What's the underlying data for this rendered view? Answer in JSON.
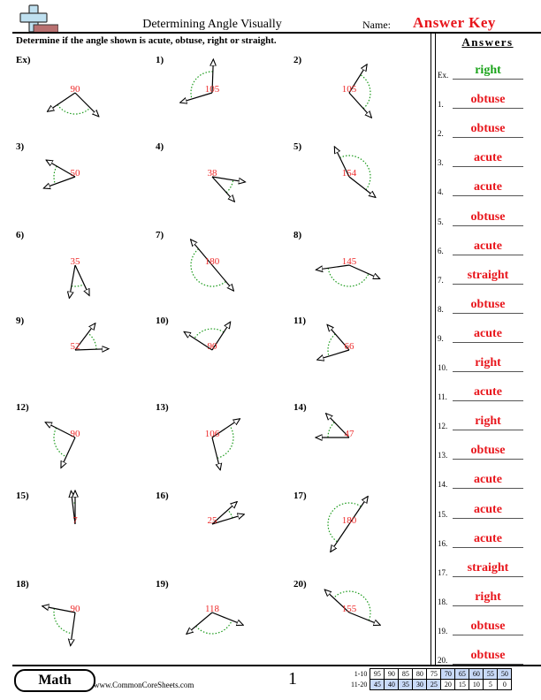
{
  "header": {
    "title": "Determining Angle Visually",
    "name_label": "Name:",
    "name_value": "Answer Key",
    "logo_icon": "plus-minus-logo-icon"
  },
  "instructions": "Determine if the angle shown is acute, obtuse, right or straight.",
  "problems": [
    {
      "label": "Ex)",
      "measure": "90",
      "rays": [
        214,
        315
      ]
    },
    {
      "label": "1)",
      "measure": "105",
      "rays": [
        88,
        197
      ]
    },
    {
      "label": "2)",
      "measure": "105",
      "rays": [
        58,
        312
      ]
    },
    {
      "label": "3)",
      "measure": "50",
      "rays": [
        150,
        200
      ]
    },
    {
      "label": "4)",
      "measure": "38",
      "rays": [
        351,
        312
      ]
    },
    {
      "label": "5)",
      "measure": "154",
      "rays": [
        116,
        322
      ]
    },
    {
      "label": "6)",
      "measure": "35",
      "rays": [
        260,
        295
      ]
    },
    {
      "label": "7)",
      "measure": "180",
      "rays": [
        130,
        310
      ]
    },
    {
      "label": "8)",
      "measure": "145",
      "rays": [
        188,
        336
      ]
    },
    {
      "label": "9)",
      "measure": "52",
      "rays": [
        53,
        2
      ]
    },
    {
      "label": "10)",
      "measure": "90",
      "rays": [
        147,
        57
      ]
    },
    {
      "label": "11)",
      "measure": "66",
      "rays": [
        131,
        197
      ]
    },
    {
      "label": "12)",
      "measure": "90",
      "rays": [
        153,
        245
      ]
    },
    {
      "label": "13)",
      "measure": "106",
      "rays": [
        34,
        284
      ]
    },
    {
      "label": "14)",
      "measure": "47",
      "rays": [
        134,
        180
      ]
    },
    {
      "label": "15)",
      "measure": "7",
      "rays": [
        97,
        90
      ]
    },
    {
      "label": "16)",
      "measure": "25",
      "rays": [
        42,
        17
      ]
    },
    {
      "label": "17)",
      "measure": "180",
      "rays": [
        56,
        236
      ]
    },
    {
      "label": "18)",
      "measure": "90",
      "rays": [
        169,
        262
      ]
    },
    {
      "label": "19)",
      "measure": "118",
      "rays": [
        220,
        338
      ]
    },
    {
      "label": "20)",
      "measure": "155",
      "rays": [
        137,
        338
      ]
    }
  ],
  "answers": {
    "title": "Answers",
    "items": [
      {
        "num": "Ex.",
        "value": "right",
        "example": true
      },
      {
        "num": "1.",
        "value": "obtuse"
      },
      {
        "num": "2.",
        "value": "obtuse"
      },
      {
        "num": "3.",
        "value": "acute"
      },
      {
        "num": "4.",
        "value": "acute"
      },
      {
        "num": "5.",
        "value": "obtuse"
      },
      {
        "num": "6.",
        "value": "acute"
      },
      {
        "num": "7.",
        "value": "straight"
      },
      {
        "num": "8.",
        "value": "obtuse"
      },
      {
        "num": "9.",
        "value": "acute"
      },
      {
        "num": "10.",
        "value": "right"
      },
      {
        "num": "11.",
        "value": "acute"
      },
      {
        "num": "12.",
        "value": "right"
      },
      {
        "num": "13.",
        "value": "obtuse"
      },
      {
        "num": "14.",
        "value": "acute"
      },
      {
        "num": "15.",
        "value": "acute"
      },
      {
        "num": "16.",
        "value": "acute"
      },
      {
        "num": "17.",
        "value": "straight"
      },
      {
        "num": "18.",
        "value": "right"
      },
      {
        "num": "19.",
        "value": "obtuse"
      },
      {
        "num": "20.",
        "value": "obtuse"
      }
    ]
  },
  "footer": {
    "subject": "Math",
    "site": "www.CommonCoreSheets.com",
    "page": "1",
    "score_rows": [
      {
        "label": "1-10",
        "scores": [
          "95",
          "90",
          "85",
          "80",
          "75",
          "70",
          "65",
          "60",
          "55",
          "50"
        ]
      },
      {
        "label": "11-20",
        "scores": [
          "45",
          "40",
          "35",
          "30",
          "25",
          "20",
          "15",
          "10",
          "5",
          "0"
        ]
      }
    ]
  },
  "colors": {
    "answer_red": "#e8161c",
    "example_green": "#1aa31a",
    "arc_green": "#1a9a1a",
    "measure_red": "#ee2a2a",
    "score_highlight": "#c9daf8"
  }
}
